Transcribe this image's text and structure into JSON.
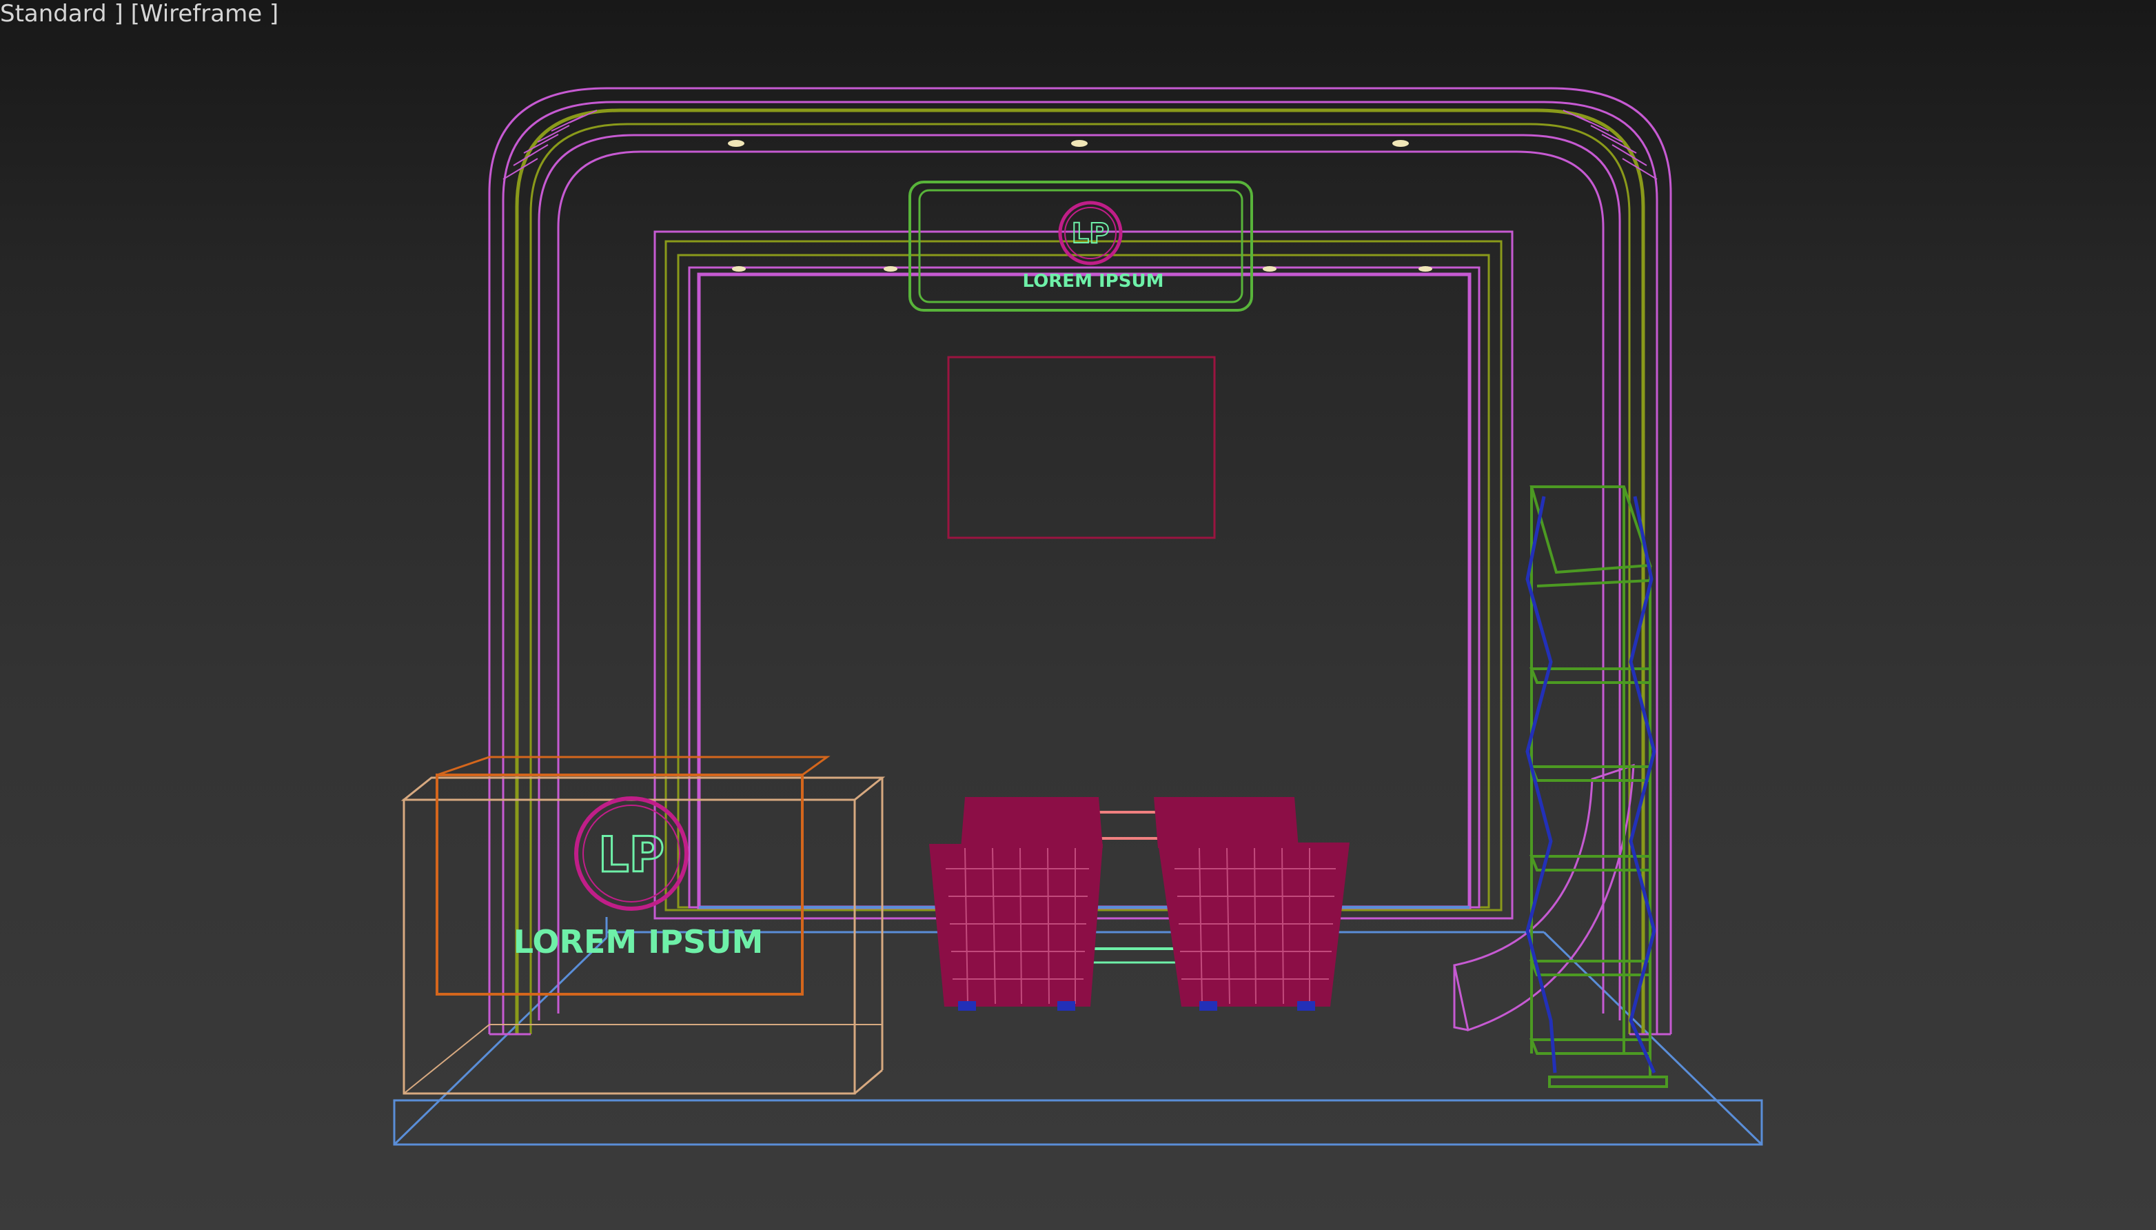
{
  "viewport": {
    "label_open": "Standard ]",
    "label_wireframe": "[Wireframe ]"
  },
  "scene": {
    "logo_text": "LP",
    "brand_text": "LOREM IPSUM"
  },
  "colors": {
    "background_top": "#181818",
    "background_bottom": "#3b3b3b",
    "arch_outline": "#c65ad2",
    "arch_inner": "#8a9a1a",
    "sign_green": "#58b43a",
    "text_mint": "#6ef0a8",
    "logo_ring": "#c01e88",
    "screen_red": "#9a1440",
    "chair_red": "#8c0e46",
    "floor_blue": "#5a8ed8",
    "counter_tan": "#d7a980",
    "counter_orange": "#d4661c",
    "shelf_green": "#4c9a22",
    "shelf_blue": "#2230b8"
  }
}
